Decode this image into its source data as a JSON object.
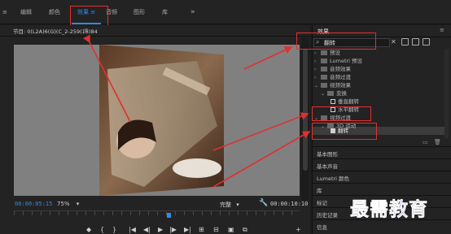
{
  "workspace": {
    "menu_glyph": "≡",
    "tabs": [
      {
        "label": "编辑"
      },
      {
        "label": "颜色"
      },
      {
        "label": "效果 ≡"
      },
      {
        "label": "音频"
      },
      {
        "label": "图形"
      },
      {
        "label": "库"
      }
    ],
    "more": "»"
  },
  "program_monitor": {
    "title": "节目: 0(L2A)6(G)(C_2-259(18)84",
    "menu": "≡",
    "timecode_current": "00:00:05:15",
    "zoom": "75%",
    "quality": "完整",
    "timecode_duration": "00:00:10:10",
    "playback_progress": 0.54,
    "controls": [
      "◆",
      "{",
      "}",
      "|◀",
      "◀|",
      "▶",
      "|▶",
      "▶|",
      "⊞",
      "⊟",
      "▣",
      "⧉",
      "+"
    ]
  },
  "effects_panel": {
    "title": "效果",
    "menu": "≡",
    "search_value": "翻转",
    "search_clear": "✕",
    "tree": [
      {
        "label": "预设",
        "expanded": false,
        "kind": "folder"
      },
      {
        "label": "Lumetri 预设",
        "expanded": false,
        "kind": "folder"
      },
      {
        "label": "音频效果",
        "expanded": false,
        "kind": "folder"
      },
      {
        "label": "音频过渡",
        "expanded": false,
        "kind": "folder"
      },
      {
        "label": "视频效果",
        "expanded": true,
        "kind": "folder"
      },
      {
        "label": "变换",
        "expanded": true,
        "kind": "folder"
      },
      {
        "label": "垂直翻转",
        "kind": "effect"
      },
      {
        "label": "水平翻转",
        "kind": "effect"
      },
      {
        "label": "视频过渡",
        "expanded": true,
        "kind": "folder"
      },
      {
        "label": "3D 运动",
        "expanded": true,
        "kind": "folder"
      },
      {
        "label": "翻转",
        "kind": "effect",
        "selected": true
      }
    ],
    "sections": [
      "基本图形",
      "基本声音",
      "Lumetri 颜色",
      "库",
      "标记",
      "历史记录",
      "信息"
    ]
  },
  "watermark": "最需教育",
  "colors": {
    "accent": "#2d8ceb",
    "annotation": "#e03030",
    "canvas": "#808080"
  }
}
